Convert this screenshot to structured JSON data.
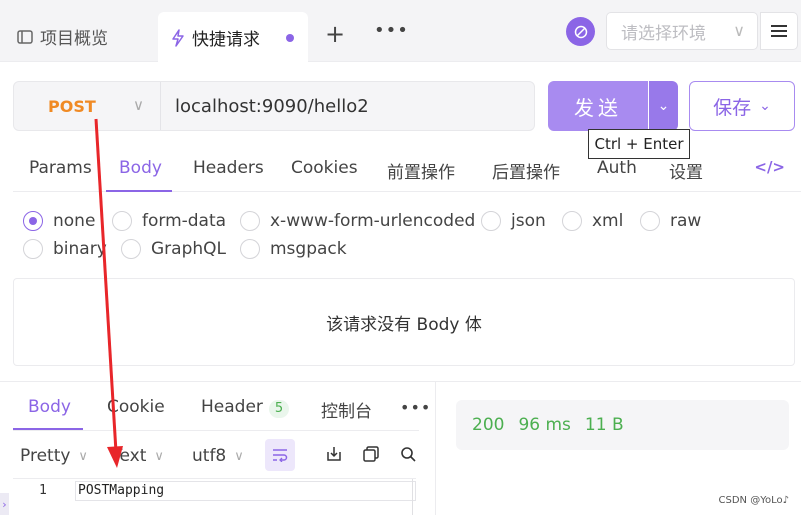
{
  "tabs": {
    "overview_label": "项目概览",
    "quick_request_label": "快捷请求",
    "add_symbol": "+",
    "more_symbol": "•••"
  },
  "env": {
    "placeholder": "请选择环境"
  },
  "request": {
    "method": "POST",
    "url": "localhost:9090/hello2",
    "send_label": "发送",
    "save_label": "保存",
    "tooltip": "Ctrl + Enter"
  },
  "request_tabs": [
    "Params",
    "Body",
    "Headers",
    "Cookies",
    "前置操作",
    "后置操作",
    "Auth",
    "设置"
  ],
  "active_request_tab": "Body",
  "body_types": [
    "none",
    "form-data",
    "x-www-form-urlencoded",
    "json",
    "xml",
    "raw",
    "binary",
    "GraphQL",
    "msgpack"
  ],
  "selected_body_type": "none",
  "empty_body_message": "该请求没有 Body 体",
  "response": {
    "tabs": {
      "body": "Body",
      "cookie": "Cookie",
      "header": "Header",
      "header_count": "5",
      "console": "控制台"
    },
    "status_code": "200",
    "time": "96 ms",
    "size": "11 B",
    "format": "Pretty",
    "type": "Text",
    "encoding": "utf8",
    "line_number": "1",
    "line_content": "POSTMapping"
  },
  "watermark": "CSDN @YoLo♪",
  "colors": {
    "accent": "#8b65e6",
    "method": "#f08a24",
    "success": "#4caf50",
    "annotation_arrow": "#e8262a"
  }
}
